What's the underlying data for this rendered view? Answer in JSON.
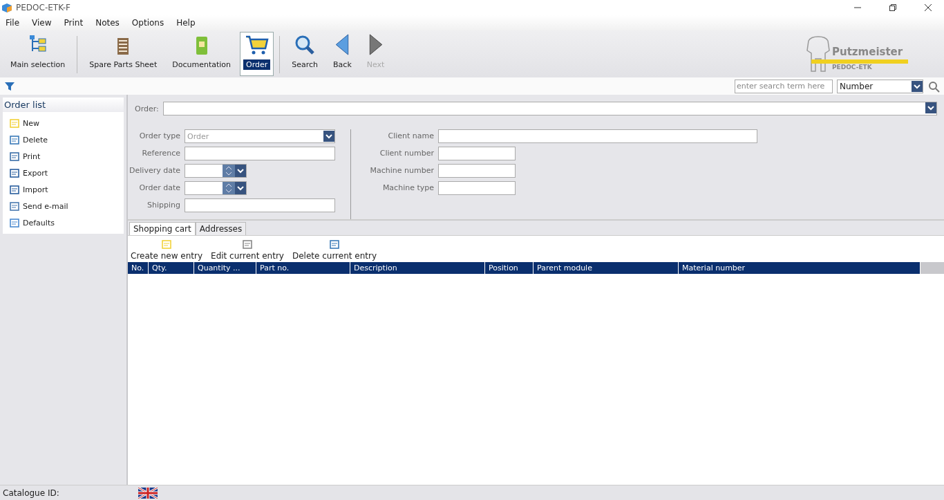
{
  "window": {
    "title": "PEDOC-ETK-F"
  },
  "menu": [
    "File",
    "View",
    "Print",
    "Notes",
    "Options",
    "Help"
  ],
  "toolbar": [
    {
      "label": "Main selection",
      "kind": "tree",
      "selected": false,
      "disabled": false
    },
    {
      "label": "Spare Parts Sheet",
      "kind": "sheet",
      "selected": false,
      "disabled": false
    },
    {
      "label": "Documentation",
      "kind": "book",
      "selected": false,
      "disabled": false
    },
    {
      "label": "Order",
      "kind": "cart",
      "selected": true,
      "disabled": false
    },
    {
      "label": "Search",
      "kind": "search",
      "selected": false,
      "disabled": false
    },
    {
      "label": "Back",
      "kind": "back",
      "selected": false,
      "disabled": false
    },
    {
      "label": "Next",
      "kind": "next",
      "selected": false,
      "disabled": true
    }
  ],
  "logo": {
    "brand": "Putzmeister",
    "product": "PEDOC-ETK"
  },
  "search": {
    "placeholder": "enter search term here",
    "mode": "Number"
  },
  "sidebar": {
    "title": "Order list",
    "items": [
      {
        "label": "New",
        "kind": "new"
      },
      {
        "label": "Delete",
        "kind": "delete"
      },
      {
        "label": "Print",
        "kind": "print"
      },
      {
        "label": "Export",
        "kind": "export"
      },
      {
        "label": "Import",
        "kind": "import"
      },
      {
        "label": "Send e-mail",
        "kind": "mail"
      },
      {
        "label": "Defaults",
        "kind": "defaults"
      }
    ]
  },
  "order": {
    "label": "Order:"
  },
  "left_fields": [
    {
      "label": "Order type",
      "kind": "select",
      "value": "Order"
    },
    {
      "label": "Reference",
      "kind": "text"
    },
    {
      "label": "Delivery date",
      "kind": "date"
    },
    {
      "label": "Order date",
      "kind": "date"
    },
    {
      "label": "Shipping",
      "kind": "text"
    }
  ],
  "right_fields": [
    {
      "label": "Client name",
      "kind": "wide"
    },
    {
      "label": "Client number",
      "kind": "short"
    },
    {
      "label": "Machine number",
      "kind": "short"
    },
    {
      "label": "Machine type",
      "kind": "short"
    }
  ],
  "tabs": [
    {
      "label": "Shopping cart",
      "selected": true
    },
    {
      "label": "Addresses",
      "selected": false
    }
  ],
  "cart_actions": [
    {
      "label": "Create new entry",
      "kind": "new"
    },
    {
      "label": "Edit current entry",
      "kind": "edit"
    },
    {
      "label": "Delete current entry",
      "kind": "delete"
    }
  ],
  "table": {
    "columns": [
      "No.",
      "Qty.",
      "Quantity ...",
      "Part no.",
      "Description",
      "Position",
      "Parent module",
      "Material number"
    ]
  },
  "status_bar": {
    "catalogue": "Catalogue ID:"
  }
}
